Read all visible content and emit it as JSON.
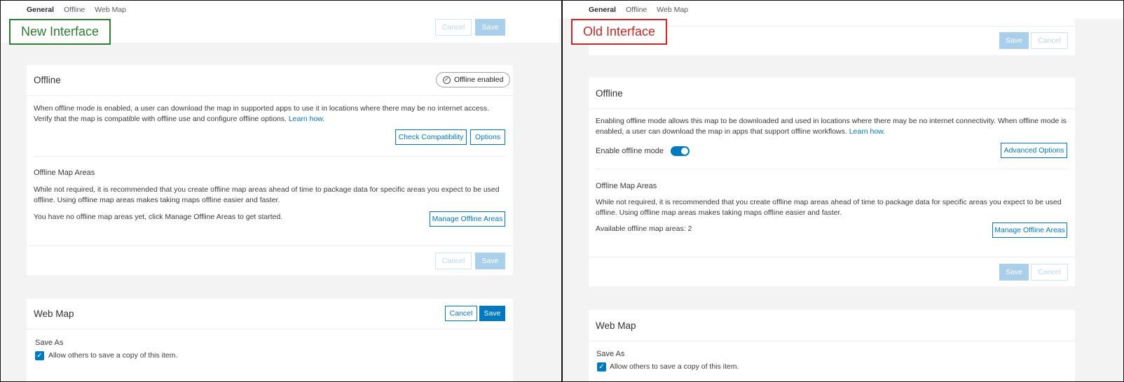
{
  "nav": {
    "general": "General",
    "offline": "Offline",
    "web_map": "Web Map"
  },
  "callouts": {
    "new": "New Interface",
    "old": "Old Interface"
  },
  "buttons": {
    "cancel": "Cancel",
    "save": "Save"
  },
  "new": {
    "offline": {
      "title": "Offline",
      "status_pill": "Offline enabled",
      "description": "When offline mode is enabled, a user can download the map in supported apps to use it in locations where there may be no internet access. Verify that the map is compatible with offline use and configure offline options.",
      "learn_how": "Learn how.",
      "check_compat": "Check Compatibility",
      "options": "Options",
      "areas_title": "Offline Map Areas",
      "areas_description": "While not required, it is recommended that you create offline map areas ahead of time to package data for specific areas you expect to be used offline. Using offline map areas makes taking maps offline easier and faster.",
      "areas_status": "You have no offline map areas yet, click Manage Offline Areas to get started.",
      "manage_areas": "Manage Offline Areas"
    },
    "webmap": {
      "title": "Web Map",
      "save_as": "Save As",
      "allow_copy": "Allow others to save a copy of this item."
    }
  },
  "old": {
    "offline": {
      "title": "Offline",
      "description": "Enabling offline mode allows this map to be downloaded and used in locations where there may be no internet connectivity. When offline mode is enabled, a user can download the map in apps that support offline workflows.",
      "learn_how": "Learn how.",
      "enable_label": "Enable offline mode",
      "advanced_options": "Advanced Options",
      "areas_title": "Offline Map Areas",
      "areas_description": "While not required, it is recommended that you create offline map areas ahead of time to package data for specific areas you expect to be used offline. Using offline map areas makes taking maps offline easier and faster.",
      "areas_status": "Available offline map areas: 2",
      "manage_areas": "Manage Offline Areas"
    },
    "webmap": {
      "title": "Web Map",
      "save_as": "Save As",
      "allow_copy": "Allow others to save a copy of this item."
    }
  },
  "colors": {
    "accent": "#0079c1",
    "new_callout": "#2e7d32",
    "old_callout": "#c62828"
  },
  "icons": {
    "status_pill": "check-circle-icon",
    "checkbox": "checkmark-icon"
  }
}
